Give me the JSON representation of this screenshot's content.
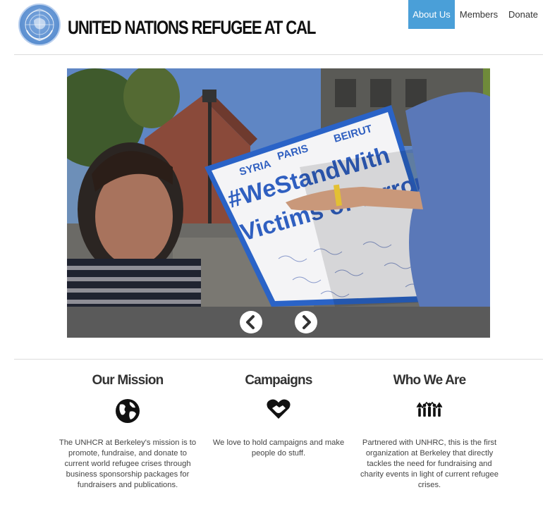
{
  "site": {
    "title": "UNITED NATIONS REFUGEE AT CAL",
    "logo_icon": "un-emblem-icon"
  },
  "nav": {
    "items": [
      {
        "label": "About Us",
        "active": true
      },
      {
        "label": "Members",
        "active": false
      },
      {
        "label": "Donate",
        "active": false
      }
    ],
    "accent_color": "#4a9fd8"
  },
  "slideshow": {
    "sign_words": [
      "SYRIA",
      "PARIS",
      "BEIRUT",
      "#WeStandWith",
      "Victims of Terror"
    ],
    "prev_icon": "chevron-left-icon",
    "next_icon": "chevron-right-icon"
  },
  "columns": [
    {
      "title": "Our Mission",
      "icon": "globe-icon",
      "text": "The UNHCR at Berkeley's mission is to promote, fundraise, and donate to current world refugee crises through business sponsorship packages for fundraisers and publications."
    },
    {
      "title": "Campaigns",
      "icon": "heart-handshake-icon",
      "text": "We love to hold campaigns and make people do stuff."
    },
    {
      "title": "Who We Are",
      "icon": "people-group-icon",
      "text": "Partnered with UNHRC, this is the first organization at Berkeley that directly tackles the need for fundraising and charity events in light of current refugee crises."
    }
  ]
}
